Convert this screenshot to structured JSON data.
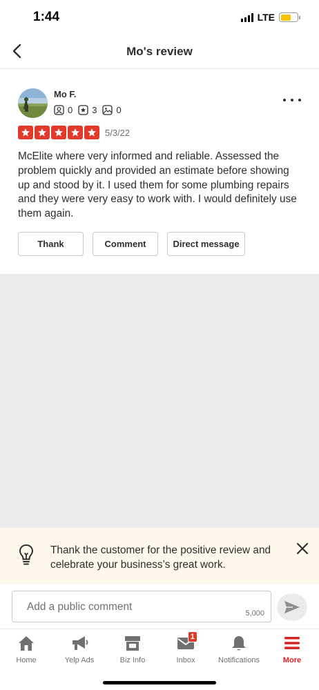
{
  "status_bar": {
    "time": "1:44",
    "network": "LTE"
  },
  "header": {
    "title": "Mo's review"
  },
  "review": {
    "user_name": "Mo F.",
    "friends_count": "0",
    "reviews_count": "3",
    "photos_count": "0",
    "rating": 5,
    "date": "5/3/22",
    "text": "McElite where very informed and reliable. Assessed the problem quickly and provided an estimate before showing up and stood by it. I used them for some plumbing repairs and they were very easy to work with. I would definitely use them again.",
    "actions": {
      "thank": "Thank",
      "comment": "Comment",
      "direct_message": "Direct message"
    }
  },
  "tip": {
    "text": "Thank the customer for the positive review and celebrate your business’s great work."
  },
  "comment": {
    "placeholder": "Add a public comment",
    "char_limit": "5,000"
  },
  "tabs": [
    {
      "label": "Home",
      "icon": "home-icon"
    },
    {
      "label": "Yelp Ads",
      "icon": "megaphone-icon"
    },
    {
      "label": "Biz Info",
      "icon": "storefront-icon"
    },
    {
      "label": "Inbox",
      "icon": "inbox-icon",
      "badge": "1"
    },
    {
      "label": "Notifications",
      "icon": "bell-icon"
    },
    {
      "label": "More",
      "icon": "hamburger-menu-icon",
      "active": true
    }
  ],
  "colors": {
    "accent": "#d32323",
    "star": "#e1392a",
    "tip_bg": "#fdf8e9",
    "gray_area": "#ebebeb"
  }
}
